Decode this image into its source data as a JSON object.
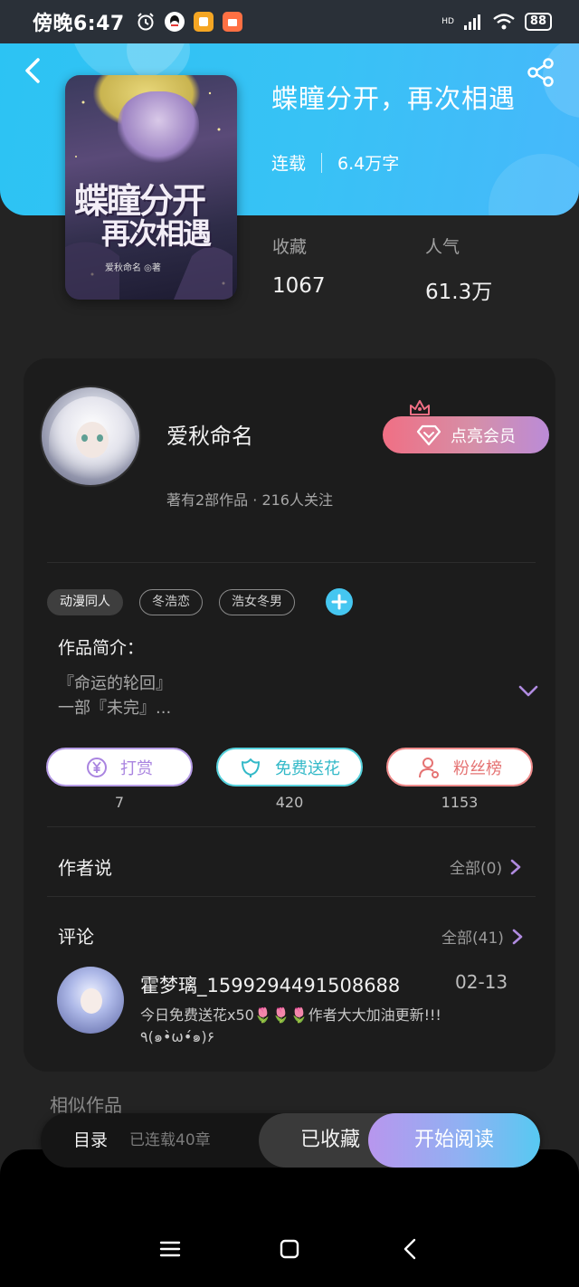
{
  "status_bar": {
    "time": "傍晚6:47",
    "network": "HD",
    "battery": "88"
  },
  "book": {
    "title": "蝶瞳分开，再次相遇",
    "status": "连载",
    "word_count": "6.4万字",
    "cover": {
      "title_line1": "蝶瞳分开",
      "title_line2": "再次相遇",
      "byline": "爱秋命名 ◎著"
    },
    "stats": [
      {
        "label": "收藏",
        "value": "1067"
      },
      {
        "label": "人气",
        "value": "61.3万"
      }
    ]
  },
  "author": {
    "name": "爱秋命名",
    "subtitle": "著有2部作品 · 216人关注",
    "vip_label": "点亮会员"
  },
  "tags": [
    "动漫同人",
    "冬浩恋",
    "浩女冬男"
  ],
  "intro": {
    "label": "作品简介：",
    "line1": "『命运的轮回』",
    "line2": "一部『未完』..."
  },
  "actions": [
    {
      "label": "打赏",
      "count": "7",
      "icon": "yen-icon"
    },
    {
      "label": "免费送花",
      "count": "420",
      "icon": "flower-icon"
    },
    {
      "label": "粉丝榜",
      "count": "1153",
      "icon": "user-icon"
    }
  ],
  "author_says": {
    "title": "作者说",
    "more": "全部(0)"
  },
  "comments": {
    "title": "评论",
    "more": "全部(41)",
    "items": [
      {
        "user": "霍梦璃_1599294491508688",
        "date": "02-13",
        "text_line1": "今日免费送花x50🌷🌷🌷作者大大加油更新!!!",
        "text_line2": "٩(๑•̀ω•́๑)۶"
      }
    ]
  },
  "similar_title": "相似作品",
  "bottom_bar": {
    "toc": "目录",
    "chapters": "已连载40章",
    "collected": "已收藏",
    "read": "开始阅读"
  },
  "colors": {
    "header": "#38c2f5",
    "card": "#1c1c1c",
    "background": "#232323"
  }
}
